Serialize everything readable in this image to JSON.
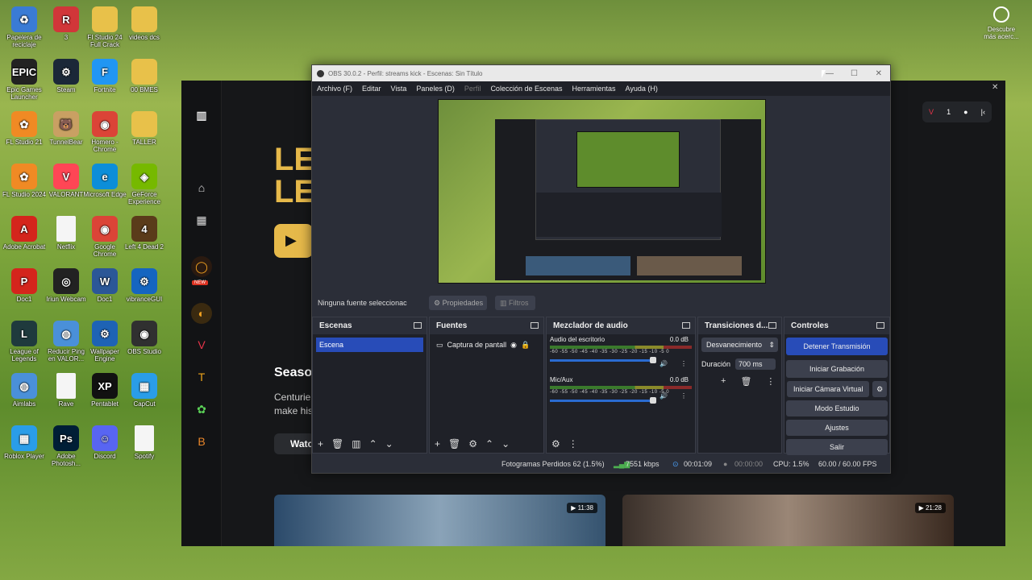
{
  "desktop": {
    "icons": [
      {
        "label": "Papelera de reciclaje",
        "name": "recycle-bin-icon",
        "color": "#3a7bd5",
        "glyph": "♻"
      },
      {
        "label": "3",
        "name": "riot-icon",
        "color": "#d13639",
        "glyph": "R"
      },
      {
        "label": "FI Studio 24 Full Crack",
        "name": "folder-icon",
        "color": "#e8c14a",
        "glyph": ""
      },
      {
        "label": "videos dcs",
        "name": "folder-icon",
        "color": "#e8c14a",
        "glyph": ""
      },
      {
        "label": "Epic Games Launcher",
        "name": "epic-games-icon",
        "color": "#222",
        "glyph": "EPIC"
      },
      {
        "label": "Steam",
        "name": "steam-icon",
        "color": "#1b2838",
        "glyph": "⚙"
      },
      {
        "label": "Fortnite",
        "name": "fortnite-icon",
        "color": "#2196f3",
        "glyph": "F"
      },
      {
        "label": "00 BMES",
        "name": "folder-icon",
        "color": "#e8c14a",
        "glyph": ""
      },
      {
        "label": "FL Studio 21",
        "name": "fl-studio-icon",
        "color": "#f08a24",
        "glyph": "✿"
      },
      {
        "label": "TunnelBear",
        "name": "tunnelbear-icon",
        "color": "#c9a063",
        "glyph": "🐻"
      },
      {
        "label": "Homero - Chrome",
        "name": "chrome-icon",
        "color": "#db4437",
        "glyph": "◉"
      },
      {
        "label": "TALLER",
        "name": "folder-icon",
        "color": "#e8c14a",
        "glyph": ""
      },
      {
        "label": "FL Studio 2024",
        "name": "fl-studio-icon",
        "color": "#f08a24",
        "glyph": "✿"
      },
      {
        "label": "VALORANT",
        "name": "valorant-icon",
        "color": "#ff4655",
        "glyph": "V"
      },
      {
        "label": "Microsoft Edge",
        "name": "edge-icon",
        "color": "#0c8ed9",
        "glyph": "e"
      },
      {
        "label": "GeForce Experience",
        "name": "geforce-icon",
        "color": "#76b900",
        "glyph": "◈"
      },
      {
        "label": "Adobe Acrobat",
        "name": "acrobat-icon",
        "color": "#d4251c",
        "glyph": "A"
      },
      {
        "label": "Netflix",
        "name": "file-icon",
        "color": "#f5f5f5",
        "glyph": ""
      },
      {
        "label": "Google Chrome",
        "name": "chrome-icon",
        "color": "#db4437",
        "glyph": "◉"
      },
      {
        "label": "Left 4 Dead 2",
        "name": "left4dead-icon",
        "color": "#5a3b1a",
        "glyph": "4"
      },
      {
        "label": "Doc1",
        "name": "pdf-icon",
        "color": "#d4251c",
        "glyph": "P"
      },
      {
        "label": "Iriun Webcam",
        "name": "iriun-icon",
        "color": "#222",
        "glyph": "◎"
      },
      {
        "label": "Doc1",
        "name": "word-icon",
        "color": "#2b5797",
        "glyph": "W"
      },
      {
        "label": "vibranceGUI",
        "name": "vibrance-icon",
        "color": "#1565c0",
        "glyph": "⚙"
      },
      {
        "label": "League of Legends",
        "name": "lol-icon",
        "color": "#1f3a3d",
        "glyph": "L"
      },
      {
        "label": "Reducir Ping en VALOR...",
        "name": "globe-icon",
        "color": "#4a90d9",
        "glyph": "◍"
      },
      {
        "label": "Wallpaper Engine",
        "name": "wallpaper-engine-icon",
        "color": "#1e63b5",
        "glyph": "⚙"
      },
      {
        "label": "OBS Studio",
        "name": "obs-icon",
        "color": "#303030",
        "glyph": "◉"
      },
      {
        "label": "Aimlabs",
        "name": "globe-icon",
        "color": "#4a90d9",
        "glyph": "◍"
      },
      {
        "label": "Rave",
        "name": "file-icon",
        "color": "#f5f5f5",
        "glyph": ""
      },
      {
        "label": "Pentablet",
        "name": "xppen-icon",
        "color": "#111",
        "glyph": "XP"
      },
      {
        "label": "CapCut",
        "name": "capcut-icon",
        "color": "#2a9de8",
        "glyph": "▦"
      },
      {
        "label": "Roblox Player",
        "name": "roblox-icon",
        "color": "#2a9de8",
        "glyph": "▦"
      },
      {
        "label": "Adobe Photosh...",
        "name": "photoshop-icon",
        "color": "#001e36",
        "glyph": "Ps"
      },
      {
        "label": "Discord",
        "name": "discord-icon",
        "color": "#5865f2",
        "glyph": "☺"
      },
      {
        "label": "Spotify",
        "name": "file-icon",
        "color": "#f5f5f5",
        "glyph": ""
      }
    ],
    "right_widget": "Descubre más acerc..."
  },
  "kick": {
    "hero_title": "LE\nLE",
    "section_title": "Seaso",
    "section_text_1": "Centurie",
    "section_text_2": "make his",
    "watch_label": "Watc",
    "badge_count": "1",
    "thumb1_duration": "11:38",
    "thumb2_duration": "21:28",
    "new_badge": "NEW"
  },
  "obs": {
    "title": "OBS 30.0.2 - Perfil: streams kick - Escenas: Sin Título",
    "menu": [
      "Archivo (F)",
      "Editar",
      "Vista",
      "Paneles (D)",
      "Perfil",
      "Colección de Escenas",
      "Herramientas",
      "Ayuda (H)"
    ],
    "no_source": "Ninguna fuente seleccionac",
    "properties": "Propiedades",
    "filters": "Filtros",
    "scenes": {
      "title": "Escenas",
      "items": [
        "Escena"
      ]
    },
    "sources": {
      "title": "Fuentes",
      "items": [
        "Captura de pantall"
      ]
    },
    "mixer": {
      "title": "Mezclador de audio",
      "channels": [
        {
          "name": "Audio del escritorio",
          "db": "0.0 dB"
        },
        {
          "name": "Mic/Aux",
          "db": "0.0 dB"
        }
      ],
      "scale": "-60 -55 -50 -45 -40 -35 -30 -25 -20 -15 -10 -5 0"
    },
    "transitions": {
      "title": "Transiciones d...",
      "type": "Desvanecimiento",
      "duration_label": "Duración",
      "duration": "700 ms"
    },
    "controls": {
      "title": "Controles",
      "buttons": [
        "Detener Transmisión",
        "Iniciar Grabación",
        "Iniciar Cámara Virtual",
        "Modo Estudio",
        "Ajustes",
        "Salir"
      ]
    },
    "status": {
      "dropped": "Fotogramas Perdidos 62 (1.5%)",
      "bitrate": "7551 kbps",
      "stream_time": "00:01:09",
      "rec_time": "00:00:00",
      "cpu": "CPU: 1.5%",
      "fps": "60.00 / 60.00 FPS"
    }
  }
}
